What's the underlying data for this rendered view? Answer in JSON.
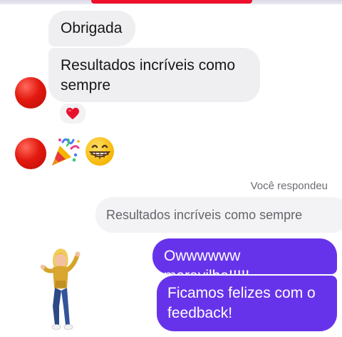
{
  "conversation": {
    "incoming": [
      {
        "text": "Obrigada"
      },
      {
        "text": "Resultados incríveis como sempre"
      }
    ],
    "reaction_icon": "heart-icon",
    "emojis": [
      "party-popper-icon",
      "grinning-face-icon"
    ],
    "reply_label": "Você respondeu",
    "reply_quote": "Resultados incríveis como sempre",
    "outgoing": [
      {
        "text": "Owwwwww maravilha!!!!!"
      },
      {
        "text": "Ficamos felizes com o feedback!"
      }
    ],
    "sticker_icon": "dancing-woman-sticker"
  },
  "colors": {
    "outgoing_bubble": "#6733ea",
    "incoming_bubble": "#efeff1",
    "avatar": "#e3190f",
    "top_accent": "#f0102b",
    "heart": "#e8112d"
  }
}
